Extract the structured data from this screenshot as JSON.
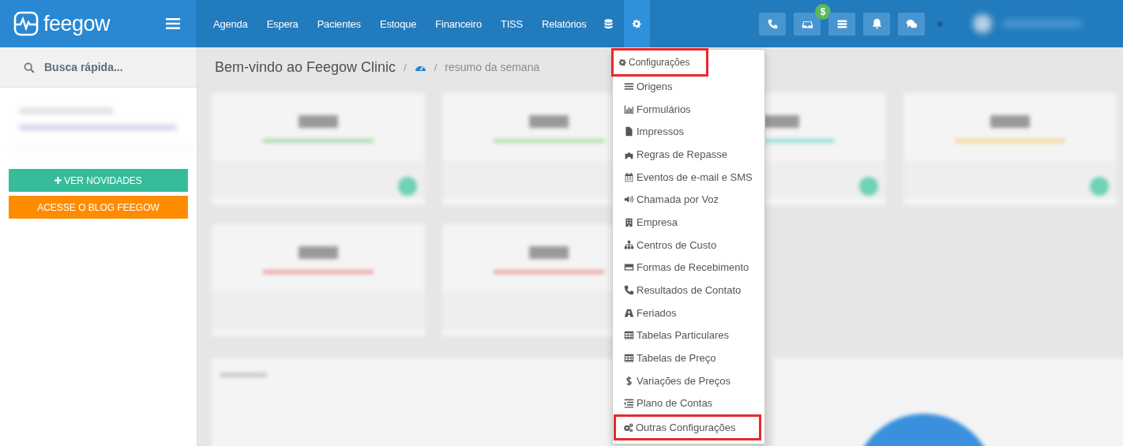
{
  "brand": {
    "name": "feegow"
  },
  "nav": [
    "Agenda",
    "Espera",
    "Pacientes",
    "Estoque",
    "Financeiro",
    "TISS",
    "Relatórios"
  ],
  "inbox_badge": "$",
  "sidebar": {
    "search": {
      "placeholder": "Busca rápida..."
    },
    "buttons": [
      {
        "label": "VER NOVIDADES",
        "kind": "news"
      },
      {
        "label": "ACESSE O BLOG FEEGOW",
        "kind": "blog"
      }
    ]
  },
  "breadcrumb": {
    "title": "Bem-vindo ao Feegow Clinic",
    "separator_1": "/",
    "separator_2": "/",
    "page": "resumo da semana"
  },
  "settings_menu": {
    "header": {
      "label": "Configurações",
      "highlighted": true
    },
    "items": [
      {
        "label": "Origens",
        "highlighted": false
      },
      {
        "label": "Formulários",
        "highlighted": false
      },
      {
        "label": "Impressos",
        "highlighted": false
      },
      {
        "label": "Regras de Repasse",
        "highlighted": false
      },
      {
        "label": "Eventos de e-mail e SMS",
        "highlighted": false
      },
      {
        "label": "Chamada por Voz",
        "highlighted": false
      },
      {
        "label": "Empresa",
        "highlighted": false
      },
      {
        "label": "Centros de Custo",
        "highlighted": false
      },
      {
        "label": "Formas de Recebimento",
        "highlighted": false
      },
      {
        "label": "Resultados de Contato",
        "highlighted": false
      },
      {
        "label": "Feriados",
        "highlighted": false
      },
      {
        "label": "Tabelas Particulares",
        "highlighted": false
      },
      {
        "label": "Tabelas de Preço",
        "highlighted": false
      },
      {
        "label": "Variações de Preços",
        "highlighted": false
      },
      {
        "label": "Plano de Contas",
        "highlighted": false
      },
      {
        "label": "Outras Configurações",
        "highlighted": true
      }
    ]
  }
}
